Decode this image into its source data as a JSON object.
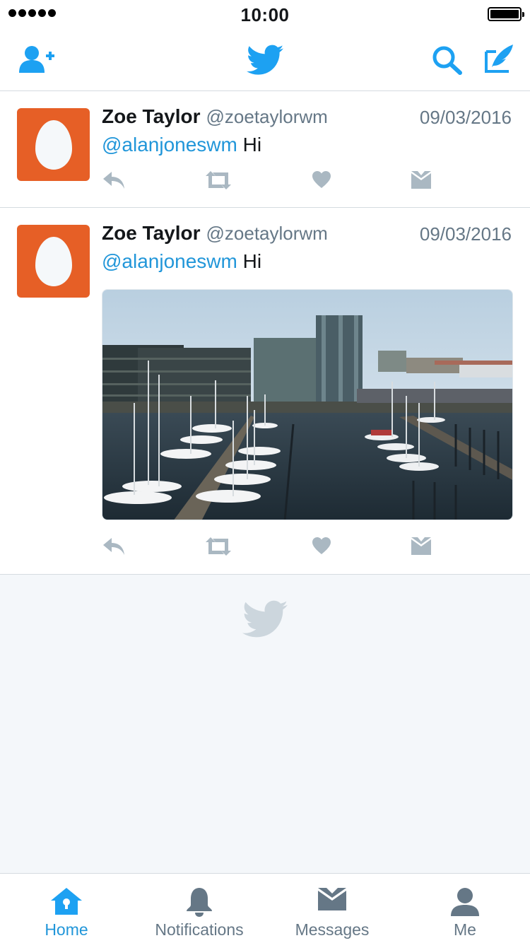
{
  "status_bar": {
    "time": "10:00",
    "signal_icon": "signal-dots-icon",
    "battery_icon": "battery-full-icon"
  },
  "nav": {
    "left_icon": "add-user-icon",
    "center_icon": "twitter-bird-icon",
    "right_icons": [
      "search-icon",
      "compose-tweet-icon"
    ],
    "accent_color": "#1da1f2"
  },
  "tweets": [
    {
      "name": "Zoe Taylor",
      "handle": "@zoetaylorwm",
      "date": "09/03/2016",
      "mention": "@alanjoneswm",
      "text": " Hi",
      "has_media": false,
      "actions": [
        "reply-icon",
        "retweet-icon",
        "like-icon",
        "direct-message-icon"
      ]
    },
    {
      "name": "Zoe Taylor",
      "handle": "@zoetaylorwm",
      "date": "09/03/2016",
      "mention": "@alanjoneswm",
      "text": " Hi",
      "has_media": true,
      "media_description_icon": "harbor-photo",
      "actions": [
        "reply-icon",
        "retweet-icon",
        "like-icon",
        "direct-message-icon"
      ]
    }
  ],
  "feed_end_icon": "twitter-bird-icon",
  "tab_bar": {
    "tabs": [
      {
        "label": "Home",
        "icon": "home-icon",
        "active": true
      },
      {
        "label": "Notifications",
        "icon": "bell-icon",
        "active": false
      },
      {
        "label": "Messages",
        "icon": "envelope-icon",
        "active": false
      },
      {
        "label": "Me",
        "icon": "profile-icon",
        "active": false
      }
    ],
    "active_color": "#1da1f2",
    "inactive_color": "#657786"
  }
}
